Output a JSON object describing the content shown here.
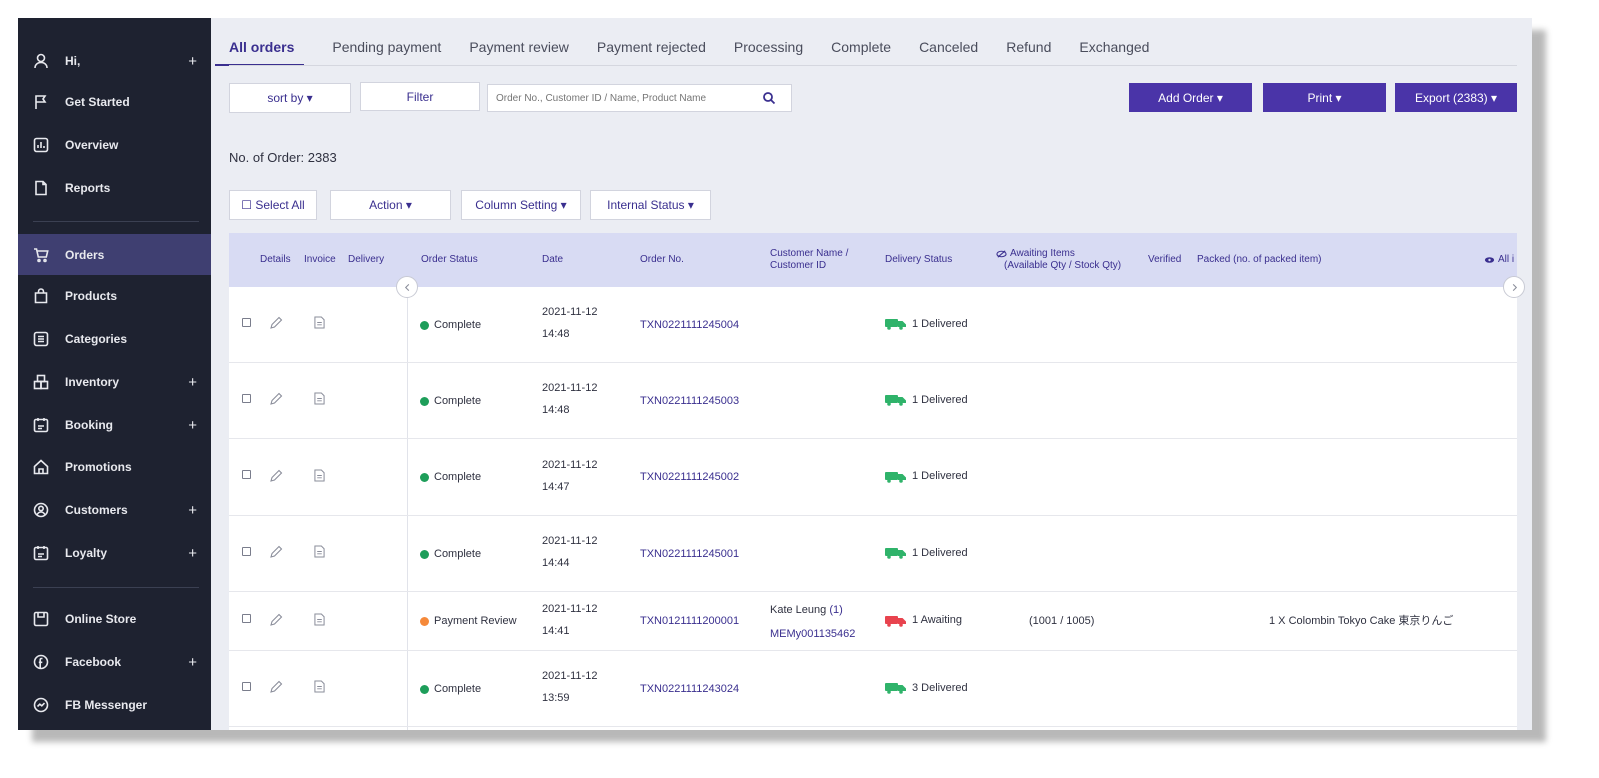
{
  "sidebar": {
    "items": [
      {
        "label": "Hi,",
        "icon": "user-icon",
        "plus": "+"
      },
      {
        "label": "Get Started",
        "icon": "flag-icon"
      },
      {
        "label": "Overview",
        "icon": "chart-icon"
      },
      {
        "label": "Reports",
        "icon": "document-icon"
      },
      {
        "label": "Orders",
        "icon": "cart-icon"
      },
      {
        "label": "Products",
        "icon": "bag-icon"
      },
      {
        "label": "Categories",
        "icon": "list-icon"
      },
      {
        "label": "Inventory",
        "icon": "boxes-icon",
        "plus": "+"
      },
      {
        "label": "Booking",
        "icon": "calendar-icon",
        "plus": "+"
      },
      {
        "label": "Promotions",
        "icon": "house-icon"
      },
      {
        "label": "Customers",
        "icon": "customer-icon",
        "plus": "+"
      },
      {
        "label": "Loyalty",
        "icon": "loyalty-icon",
        "plus": "+"
      },
      {
        "label": "Online Store",
        "icon": "store-icon"
      },
      {
        "label": "Facebook",
        "icon": "facebook-icon",
        "plus": "+"
      },
      {
        "label": "FB Messenger",
        "icon": "messenger-icon"
      }
    ]
  },
  "tabs": [
    "All orders",
    "Pending payment",
    "Payment review",
    "Payment rejected",
    "Processing",
    "Complete",
    "Canceled",
    "Refund",
    "Exchanged"
  ],
  "toolbar": {
    "sort_label": "sort by ▾",
    "filter_label": "Filter",
    "search_placeholder": "Order No., Customer ID / Name, Product Name",
    "add_order_label": "Add Order ▾",
    "print_label": "Print ▾",
    "export_label": "Export (2383) ▾"
  },
  "order_count": "No. of Order: 2383",
  "actions": {
    "select_all": "☐ Select All",
    "action": "Action ▾",
    "column_setting": "Column Setting ▾",
    "internal_status": "Internal Status ▾"
  },
  "columns": {
    "details": "Details",
    "invoice": "Invoice",
    "delivery": "Delivery",
    "order_status": "Order Status",
    "date": "Date",
    "order_no": "Order No.",
    "customer_line1": "Customer Name /",
    "customer_line2": "Customer ID",
    "delivery_status": "Delivery Status",
    "awaiting_line1": "Awaiting Items",
    "awaiting_line2": "(Available Qty / Stock Qty)",
    "verified": "Verified",
    "packed": "Packed (no. of packed item)",
    "all": "All i"
  },
  "colors": {
    "complete": "#1e9e5a",
    "payment_review": "#f5893a",
    "delivered_truck": "#2fb36a",
    "awaiting_truck": "#e8434e",
    "accent": "#4a34a8"
  },
  "orders": [
    {
      "status": "Complete",
      "status_color": "#1e9e5a",
      "date": "2021-11-12",
      "time": "14:48",
      "order_no": "TXN0221111245004",
      "customer_name": "",
      "customer_count": "",
      "customer_id": "",
      "delivery": "1 Delivered",
      "truck": "#2fb36a",
      "awaiting": "",
      "packed": ""
    },
    {
      "status": "Complete",
      "status_color": "#1e9e5a",
      "date": "2021-11-12",
      "time": "14:48",
      "order_no": "TXN0221111245003",
      "customer_name": "",
      "customer_count": "",
      "customer_id": "",
      "delivery": "1 Delivered",
      "truck": "#2fb36a",
      "awaiting": "",
      "packed": ""
    },
    {
      "status": "Complete",
      "status_color": "#1e9e5a",
      "date": "2021-11-12",
      "time": "14:47",
      "order_no": "TXN0221111245002",
      "customer_name": "",
      "customer_count": "",
      "customer_id": "",
      "delivery": "1 Delivered",
      "truck": "#2fb36a",
      "awaiting": "",
      "packed": ""
    },
    {
      "status": "Complete",
      "status_color": "#1e9e5a",
      "date": "2021-11-12",
      "time": "14:44",
      "order_no": "TXN0221111245001",
      "customer_name": "",
      "customer_count": "",
      "customer_id": "",
      "delivery": "1 Delivered",
      "truck": "#2fb36a",
      "awaiting": "",
      "packed": ""
    },
    {
      "status": "Payment Review",
      "status_color": "#f5893a",
      "date": "2021-11-12",
      "time": "14:41",
      "order_no": "TXN0121111200001",
      "customer_name": "Kate Leung",
      "customer_count": "(1)",
      "customer_id": "MEMy001135462",
      "delivery": "1 Awaiting",
      "truck": "#e8434e",
      "awaiting": "(1001 / 1005)",
      "packed": "1 X Colombin Tokyo Cake 東京りんご"
    },
    {
      "status": "Complete",
      "status_color": "#1e9e5a",
      "date": "2021-11-12",
      "time": "13:59",
      "order_no": "TXN0221111243024",
      "customer_name": "",
      "customer_count": "",
      "customer_id": "",
      "delivery": "3 Delivered",
      "truck": "#2fb36a",
      "awaiting": "",
      "packed": ""
    }
  ]
}
